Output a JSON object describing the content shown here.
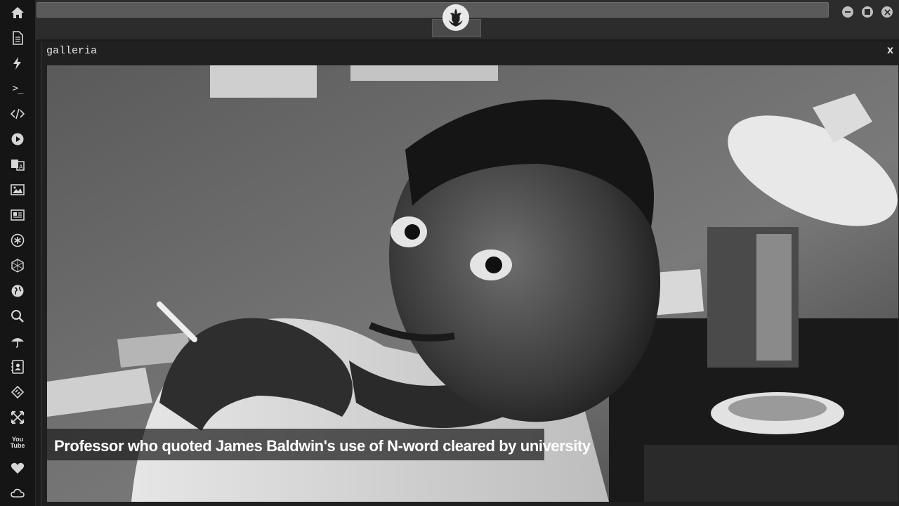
{
  "sidebar": {
    "items": [
      {
        "icon": "home-icon"
      },
      {
        "icon": "document-icon"
      },
      {
        "icon": "lightning-icon"
      },
      {
        "icon": "terminal-icon",
        "glyph": ">_"
      },
      {
        "icon": "code-icon"
      },
      {
        "icon": "play-icon"
      },
      {
        "icon": "translate-icon"
      },
      {
        "icon": "image-icon"
      },
      {
        "icon": "newspaper-icon"
      },
      {
        "icon": "asterisk-icon"
      },
      {
        "icon": "hexagon-icon"
      },
      {
        "icon": "globe-icon"
      },
      {
        "icon": "search-icon"
      },
      {
        "icon": "umbrella-icon"
      },
      {
        "icon": "contact-card-icon"
      },
      {
        "icon": "embed-icon"
      },
      {
        "icon": "expand-icon"
      },
      {
        "icon": "youtube-icon",
        "glyph_top": "You",
        "glyph_bottom": "Tube"
      },
      {
        "icon": "heart-icon"
      },
      {
        "icon": "cloud-icon"
      }
    ]
  },
  "topbar": {
    "address_value": "",
    "logo_icon": "rebel-alliance-icon",
    "window_buttons": [
      "minimize-icon",
      "maximize-icon",
      "close-icon"
    ]
  },
  "window": {
    "title": "galleria",
    "close_label": "x",
    "photo": {
      "description_icon": "photo-black-white-portrait",
      "caption": "Professor who quoted James Baldwin's use of N-word cleared by university"
    }
  },
  "colors": {
    "background": "#1c1c1c",
    "rail": "#151515",
    "chrome": "#2c2c2c",
    "address_bar": "#5a5a5a",
    "caption_bg": "#1e1e1e",
    "text": "#ffffff"
  }
}
